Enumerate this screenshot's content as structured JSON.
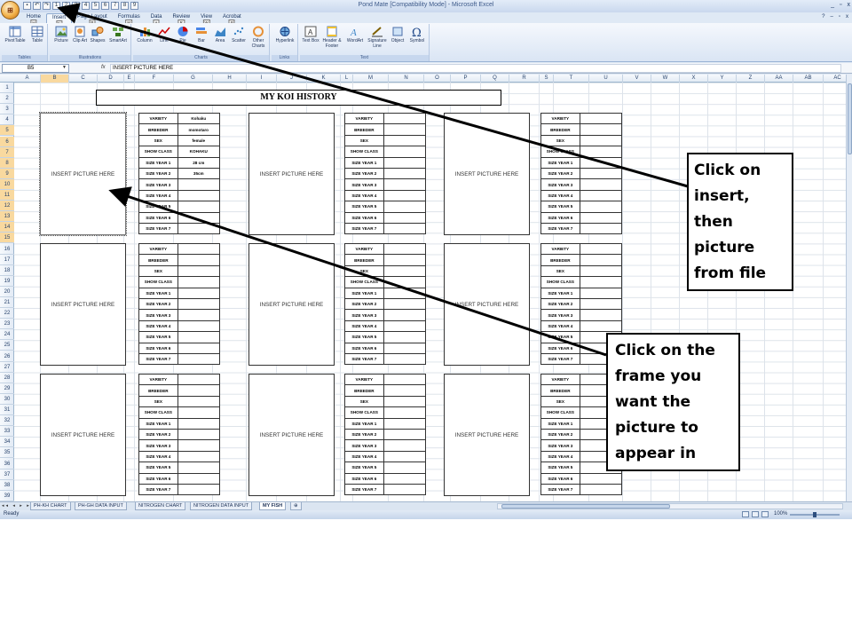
{
  "window": {
    "title": "Pond Mate  [Compatibility Mode] - Microsoft Excel",
    "office_button": "",
    "controls": [
      "_",
      "▫",
      "x"
    ]
  },
  "ribbon_tabs": [
    {
      "label": "Home",
      "key": "H"
    },
    {
      "label": "Insert",
      "key": "N",
      "active": true
    },
    {
      "label": "Page Layout",
      "key": "P"
    },
    {
      "label": "Formulas",
      "key": "M"
    },
    {
      "label": "Data",
      "key": "A"
    },
    {
      "label": "Review",
      "key": "R"
    },
    {
      "label": "View",
      "key": "W"
    },
    {
      "label": "Acrobat",
      "key": "B"
    }
  ],
  "ribbon_groups": {
    "tables": {
      "label": "Tables",
      "buttons": [
        "PivotTable",
        "Table"
      ]
    },
    "illustrations": {
      "label": "Illustrations",
      "buttons": [
        "Picture",
        "Clip Art",
        "Shapes",
        "SmartArt"
      ]
    },
    "charts": {
      "label": "Charts",
      "buttons": [
        "Column",
        "Line",
        "Pie",
        "Bar",
        "Area",
        "Scatter",
        "Other Charts"
      ]
    },
    "links": {
      "label": "Links",
      "buttons": [
        "Hyperlink"
      ]
    },
    "text": {
      "label": "Text",
      "buttons": [
        "Text Box",
        "Header & Footer",
        "WordArt",
        "Signature Line",
        "Object",
        "Symbol"
      ]
    }
  },
  "formula_bar": {
    "name_box": "B5",
    "fx": "fx",
    "value": "INSERT PICTURE HERE"
  },
  "columns": [
    "A",
    "B",
    "C",
    "D",
    "E",
    "F",
    "G",
    "H",
    "I",
    "J",
    "K",
    "L",
    "M",
    "N",
    "O",
    "P",
    "Q",
    "R",
    "S",
    "T",
    "U",
    "V",
    "W",
    "X",
    "Y",
    "Z",
    "AA",
    "AB",
    "AC"
  ],
  "rows": [
    "1",
    "2",
    "3",
    "4",
    "5",
    "6",
    "7",
    "8",
    "9",
    "10",
    "11",
    "12",
    "13",
    "14",
    "15",
    "16",
    "17",
    "18",
    "19",
    "20",
    "21",
    "22",
    "23",
    "24",
    "25",
    "26",
    "27",
    "28",
    "29",
    "30",
    "31",
    "32",
    "33",
    "34",
    "35",
    "36",
    "37",
    "38",
    "39",
    "40"
  ],
  "sheet_title": "MY KOI HISTORY",
  "picture_placeholder": "INSERT PICTURE HERE",
  "labels": [
    "VARIETY",
    "BREEDER",
    "SEX",
    "SHOW CLASS",
    "SIZE YEAR 1",
    "SIZE YEAR 2",
    "SIZE YEAR 3",
    "SIZE YEAR 4",
    "SIZE YEAR 5",
    "SIZE YEAR 6",
    "SIZE YEAR 7"
  ],
  "first_record_values": [
    "Kohaku",
    "momotaro",
    "female",
    "KOHAKU",
    "28 cm",
    "35cm",
    "",
    "",
    "",
    "",
    ""
  ],
  "sheet_tabs": [
    "PH-KH CHART",
    "PH-GH DATA INPUT",
    "NITROGEN CHART",
    "NITROGEN DATA INPUT",
    "MY FISH"
  ],
  "active_sheet": "MY FISH",
  "status": "Ready",
  "zoom": "100%",
  "callouts": {
    "insert": "Click on insert, then picture from file",
    "frame": "Click on the frame you want the picture to appear in"
  },
  "callout_lines": {
    "insert": [
      "Click on",
      "insert,",
      "then",
      "picture",
      "from file"
    ],
    "frame": [
      "Click on the",
      "frame you",
      "want the",
      "picture to",
      "appear in"
    ]
  }
}
